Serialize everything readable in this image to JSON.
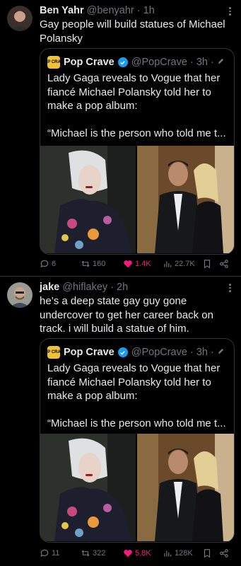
{
  "colors": {
    "background": "#000000",
    "text": "#e7e9ea",
    "muted": "#71767b",
    "like": "#f91880",
    "verified": "#1d9bf0",
    "border": "#2f3336"
  },
  "quoted": {
    "name": "Pop Crave",
    "handle": "@PopCrave · 3h ·",
    "text": "Lady Gaga reveals to Vogue that her fiancé Michael Polansky told her to make a pop album:",
    "text2": "“Michael is the person who told me t...",
    "logo_text": "POP CRAVE",
    "icons": [
      "verified-icon",
      "pencil-icon"
    ]
  },
  "tweets": [
    {
      "name": "Ben Yahr",
      "handle": "@benyahr · 1h",
      "text": "Gay people will build statues of Michael Polansky",
      "replies": "6",
      "retweets": "160",
      "likes": "1.4K",
      "views": "22.7K"
    },
    {
      "name": "jake",
      "handle": "@hiflakey · 2h",
      "text": "he’s a deep state gay guy gone undercover to get her career back on track. i will build a statue of him.",
      "replies": "11",
      "retweets": "322",
      "likes": "5.8K",
      "views": "128K"
    }
  ]
}
